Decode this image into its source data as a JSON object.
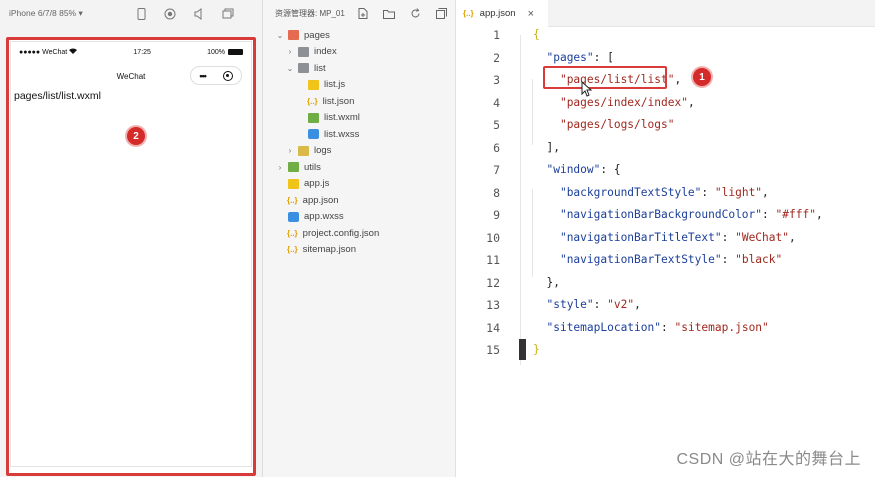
{
  "simulator": {
    "device_label": "iPhone 6/7/8 85% ▾",
    "toolbar_icons": [
      "phone-icon",
      "record-icon",
      "volume-icon",
      "window-icon"
    ],
    "status": {
      "carrier": "●●●●● WeChat",
      "time": "17:25",
      "battery": "100%"
    },
    "nav_title": "WeChat",
    "capsule_dots": "•••",
    "page_text": "pages/list/list.wxml",
    "badge": "2"
  },
  "explorer": {
    "title": "资源管理器: MP_01",
    "items": [
      {
        "label": "pages",
        "icon": "folder-red",
        "chevron": "⌄"
      },
      {
        "label": "index",
        "icon": "folder",
        "chevron": "›"
      },
      {
        "label": "list",
        "icon": "folder",
        "chevron": "⌄"
      },
      {
        "label": "list.js",
        "icon": "js"
      },
      {
        "label": "list.json",
        "icon": "json"
      },
      {
        "label": "list.wxml",
        "icon": "wxml"
      },
      {
        "label": "list.wxss",
        "icon": "wxss"
      },
      {
        "label": "logs",
        "icon": "folder-yellow",
        "chevron": "›"
      },
      {
        "label": "utils",
        "icon": "folder-green",
        "chevron": "›"
      },
      {
        "label": "app.js",
        "icon": "js"
      },
      {
        "label": "app.json",
        "icon": "json"
      },
      {
        "label": "app.wxss",
        "icon": "wxss"
      },
      {
        "label": "project.config.json",
        "icon": "json"
      },
      {
        "label": "sitemap.json",
        "icon": "json"
      }
    ],
    "json_glyph": "{..}"
  },
  "editor": {
    "tab_label": "app.json",
    "tab_icon": "{..}",
    "tab_close": "×",
    "lines": [
      {
        "n": "1",
        "parts": [
          [
            "brk",
            "{"
          ]
        ]
      },
      {
        "n": "2",
        "parts": [
          [
            "pun",
            "  "
          ],
          [
            "key",
            "\"pages\""
          ],
          [
            "pun",
            ": "
          ],
          [
            "pun",
            "["
          ]
        ]
      },
      {
        "n": "3",
        "parts": [
          [
            "pun",
            "    "
          ],
          [
            "str",
            "\"pages/list/list\""
          ],
          [
            "pun",
            ","
          ]
        ]
      },
      {
        "n": "4",
        "parts": [
          [
            "pun",
            "    "
          ],
          [
            "str",
            "\"pages/index/index\""
          ],
          [
            "pun",
            ","
          ]
        ]
      },
      {
        "n": "5",
        "parts": [
          [
            "pun",
            "    "
          ],
          [
            "str",
            "\"pages/logs/logs\""
          ]
        ]
      },
      {
        "n": "6",
        "parts": [
          [
            "pun",
            "  "
          ],
          [
            "pun",
            "],"
          ]
        ]
      },
      {
        "n": "7",
        "parts": [
          [
            "pun",
            "  "
          ],
          [
            "key",
            "\"window\""
          ],
          [
            "pun",
            ": {"
          ]
        ]
      },
      {
        "n": "8",
        "parts": [
          [
            "pun",
            "    "
          ],
          [
            "key",
            "\"backgroundTextStyle\""
          ],
          [
            "pun",
            ": "
          ],
          [
            "str",
            "\"light\""
          ],
          [
            "pun",
            ","
          ]
        ]
      },
      {
        "n": "9",
        "parts": [
          [
            "pun",
            "    "
          ],
          [
            "key",
            "\"navigationBarBackgroundColor\""
          ],
          [
            "pun",
            ": "
          ],
          [
            "str",
            "\"#fff\""
          ],
          [
            "pun",
            ","
          ]
        ]
      },
      {
        "n": "10",
        "parts": [
          [
            "pun",
            "    "
          ],
          [
            "key",
            "\"navigationBarTitleText\""
          ],
          [
            "pun",
            ": "
          ],
          [
            "str",
            "\"WeChat\""
          ],
          [
            "pun",
            ","
          ]
        ]
      },
      {
        "n": "11",
        "parts": [
          [
            "pun",
            "    "
          ],
          [
            "key",
            "\"navigationBarTextStyle\""
          ],
          [
            "pun",
            ": "
          ],
          [
            "str",
            "\"black\""
          ]
        ]
      },
      {
        "n": "12",
        "parts": [
          [
            "pun",
            "  "
          ],
          [
            "pun",
            "},"
          ]
        ]
      },
      {
        "n": "13",
        "parts": [
          [
            "pun",
            "  "
          ],
          [
            "key",
            "\"style\""
          ],
          [
            "pun",
            ": "
          ],
          [
            "str",
            "\"v2\""
          ],
          [
            "pun",
            ","
          ]
        ]
      },
      {
        "n": "14",
        "parts": [
          [
            "pun",
            "  "
          ],
          [
            "key",
            "\"sitemapLocation\""
          ],
          [
            "pun",
            ": "
          ],
          [
            "str",
            "\"sitemap.json\""
          ]
        ]
      },
      {
        "n": "15",
        "parts": [
          [
            "brk",
            "}"
          ]
        ]
      }
    ],
    "badge": "1"
  },
  "watermark": "CSDN @站在大的舞台上",
  "colors": {
    "annotation_red": "#d93a3a",
    "string": "#a0281f",
    "key": "#1c3f9a"
  }
}
